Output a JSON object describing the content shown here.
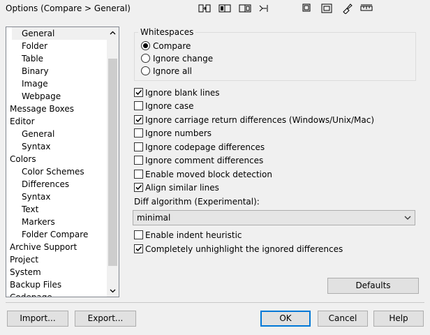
{
  "window": {
    "title": "Options (Compare > General)"
  },
  "toolbar_icons": [
    "compare-folders-icon",
    "compare-files-icon",
    "window-panes-icon",
    "merge-arrow-icon",
    "copy-window-icon",
    "sync-scroll-icon",
    "paint-brush-icon",
    "ruler-icon"
  ],
  "tree": {
    "items": [
      {
        "label": "General",
        "indent": 1,
        "selected": true
      },
      {
        "label": "Folder",
        "indent": 1
      },
      {
        "label": "Table",
        "indent": 1
      },
      {
        "label": "Binary",
        "indent": 1
      },
      {
        "label": "Image",
        "indent": 1
      },
      {
        "label": "Webpage",
        "indent": 1
      },
      {
        "label": "Message Boxes",
        "indent": 0
      },
      {
        "label": "Editor",
        "indent": 0
      },
      {
        "label": "General",
        "indent": 1
      },
      {
        "label": "Syntax",
        "indent": 1
      },
      {
        "label": "Colors",
        "indent": 0
      },
      {
        "label": "Color Schemes",
        "indent": 1
      },
      {
        "label": "Differences",
        "indent": 1
      },
      {
        "label": "Syntax",
        "indent": 1
      },
      {
        "label": "Text",
        "indent": 1
      },
      {
        "label": "Markers",
        "indent": 1
      },
      {
        "label": "Folder Compare",
        "indent": 1
      },
      {
        "label": "Archive Support",
        "indent": 0
      },
      {
        "label": "Project",
        "indent": 0
      },
      {
        "label": "System",
        "indent": 0
      },
      {
        "label": "Backup Files",
        "indent": 0
      },
      {
        "label": "Codepage",
        "indent": 0
      }
    ]
  },
  "whitespaces": {
    "legend": "Whitespaces",
    "options": [
      {
        "label": "Compare",
        "selected": true
      },
      {
        "label": "Ignore change",
        "selected": false
      },
      {
        "label": "Ignore all",
        "selected": false
      }
    ]
  },
  "checkboxes": [
    {
      "label": "Ignore blank lines",
      "checked": true
    },
    {
      "label": "Ignore case",
      "checked": false
    },
    {
      "label": "Ignore carriage return differences (Windows/Unix/Mac)",
      "checked": true
    },
    {
      "label": "Ignore numbers",
      "checked": false
    },
    {
      "label": "Ignore codepage differences",
      "checked": false
    },
    {
      "label": "Ignore comment differences",
      "checked": false
    },
    {
      "label": "Enable moved block detection",
      "checked": false
    },
    {
      "label": "Align similar lines",
      "checked": true
    }
  ],
  "diff_algorithm": {
    "label": "Diff algorithm (Experimental):",
    "value": "minimal"
  },
  "checkboxes2": [
    {
      "label": "Enable indent heuristic",
      "checked": false
    },
    {
      "label": "Completely unhighlight the ignored differences",
      "checked": true
    }
  ],
  "buttons": {
    "defaults": "Defaults",
    "import": "Import...",
    "export": "Export...",
    "ok": "OK",
    "cancel": "Cancel",
    "help": "Help"
  }
}
